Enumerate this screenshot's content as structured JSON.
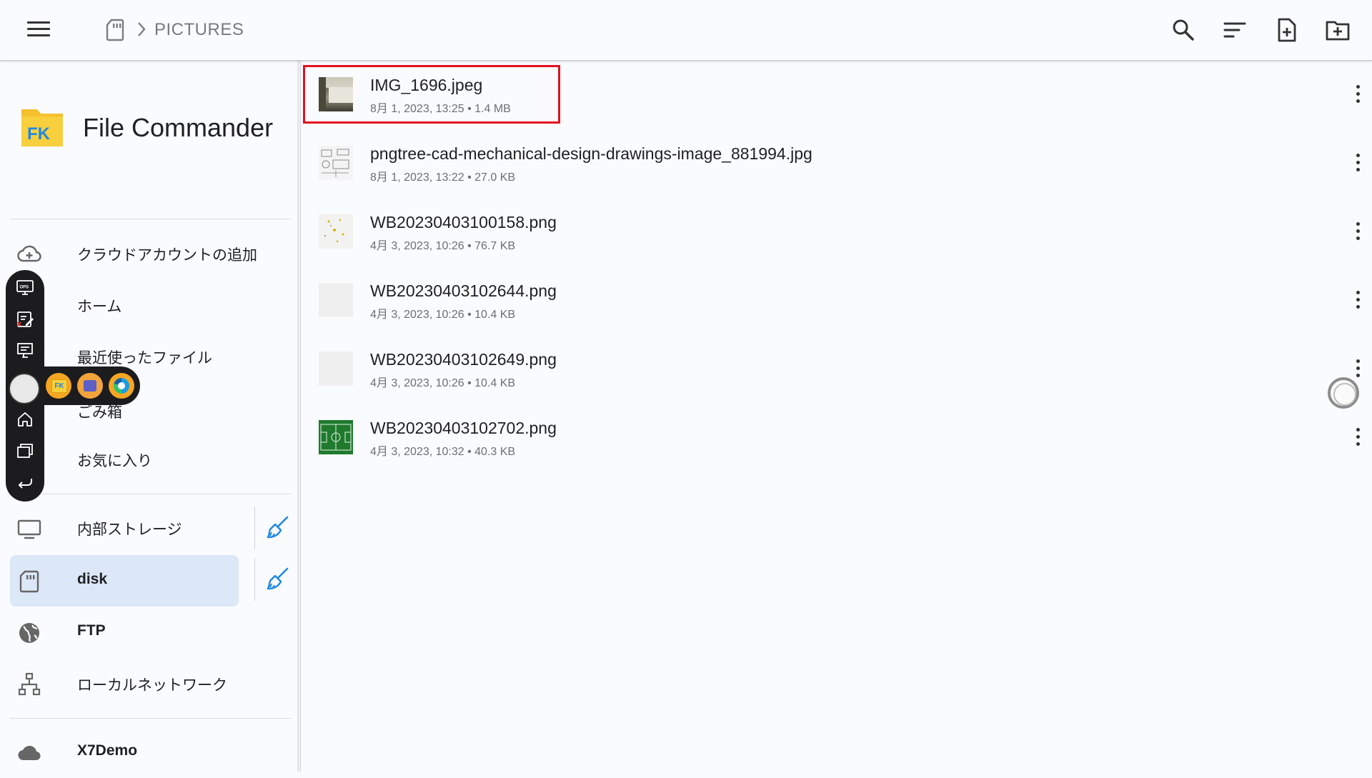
{
  "header": {
    "breadcrumb": "PICTURES",
    "actions": [
      "search-icon",
      "sort-icon",
      "new-file-icon",
      "new-folder-icon"
    ]
  },
  "sidebar": {
    "app_name": "File Commander",
    "logo_text": "FK",
    "items": [
      {
        "label": "クラウドアカウントの追加",
        "icon": "cloud-add-icon"
      },
      {
        "label": "ホーム",
        "icon": "home-icon"
      },
      {
        "label": "最近使ったファイル",
        "icon": "recent-icon"
      },
      {
        "label": "ごみ箱",
        "icon": "trash-icon"
      },
      {
        "label": "お気に入り",
        "icon": "favorite-icon"
      },
      {
        "label": "内部ストレージ",
        "icon": "monitor-icon"
      },
      {
        "label": "disk",
        "icon": "sd-card-icon",
        "active": true
      },
      {
        "label": "FTP",
        "icon": "globe-icon"
      },
      {
        "label": "ローカルネットワーク",
        "icon": "network-icon"
      },
      {
        "label": "X7Demo",
        "icon": "cloud-icon"
      }
    ]
  },
  "files": [
    {
      "name": "IMG_1696.jpeg",
      "meta": "8月 1, 2023, 13:25 • 1.4 MB"
    },
    {
      "name": "pngtree-cad-mechanical-design-drawings-image_881994.jpg",
      "meta": "8月 1, 2023, 13:22 • 27.0 KB"
    },
    {
      "name": "WB20230403100158.png",
      "meta": "4月 3, 2023, 10:26 • 76.7 KB"
    },
    {
      "name": "WB20230403102644.png",
      "meta": "4月 3, 2023, 10:26 • 10.4 KB"
    },
    {
      "name": "WB20230403102649.png",
      "meta": "4月 3, 2023, 10:26 • 10.4 KB"
    },
    {
      "name": "WB20230403102702.png",
      "meta": "4月 3, 2023, 10:32 • 40.3 KB"
    }
  ],
  "colors": {
    "accent_active": "#dce7f7",
    "highlight_box": "#e3101e",
    "logo_yellow": "#f5c02e",
    "logo_blue": "#1e88e5",
    "broom_blue": "#1e88e5"
  }
}
